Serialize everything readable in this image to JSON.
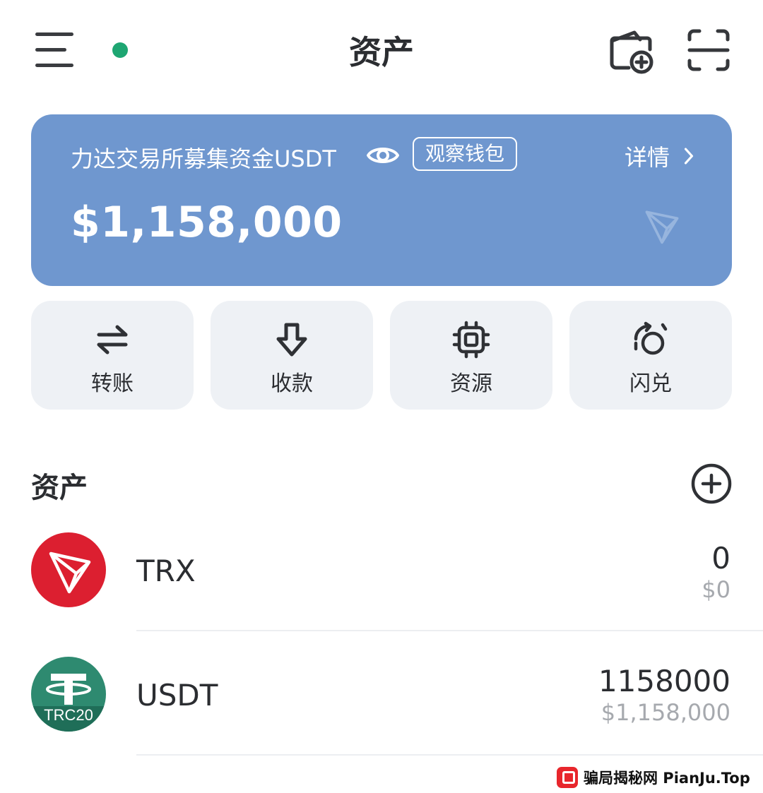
{
  "header": {
    "title": "资产"
  },
  "wallet": {
    "name": "力达交易所募集资金USDT",
    "badge": "观察钱包",
    "details": "详情",
    "balance": "$1,158,000"
  },
  "actions": [
    {
      "label": "转账",
      "icon": "transfer-icon"
    },
    {
      "label": "收款",
      "icon": "receive-icon"
    },
    {
      "label": "资源",
      "icon": "resource-chip-icon"
    },
    {
      "label": "闪兑",
      "icon": "swap-icon"
    }
  ],
  "assets": {
    "title": "资产",
    "items": [
      {
        "symbol": "TRX",
        "amount": "0",
        "value": "$0",
        "color": "#dc1f30"
      },
      {
        "symbol": "USDT",
        "amount": "1158000",
        "value": "$1,158,000",
        "color": "#2e8a70",
        "tag": "TRC20"
      }
    ]
  },
  "colors": {
    "card": "#6f97cf",
    "online": "#1ea672",
    "tile": "#eef1f5"
  },
  "watermark": {
    "text": "骗局揭秘网  PianJu.Top"
  }
}
